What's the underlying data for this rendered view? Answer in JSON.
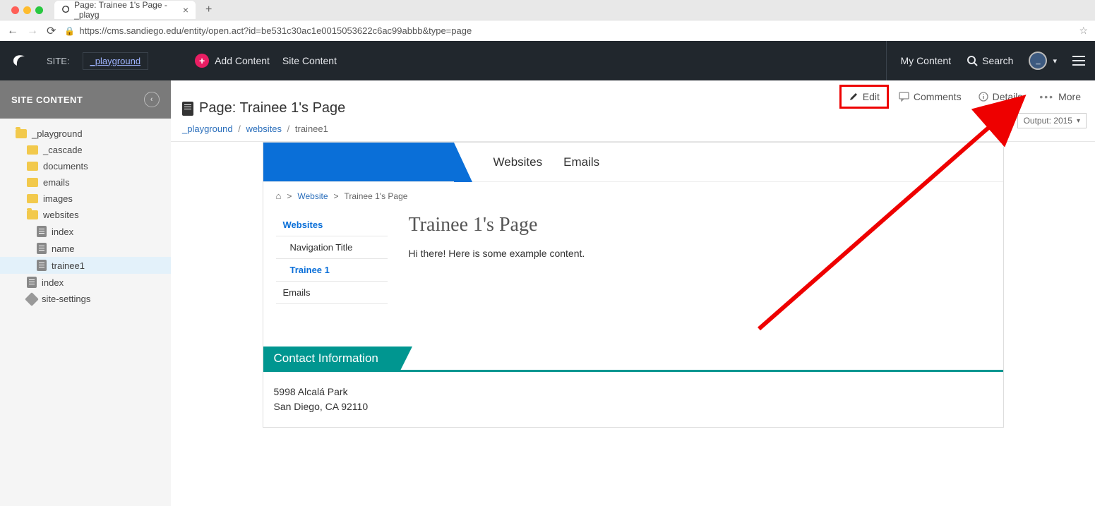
{
  "browser": {
    "tab_title": "Page: Trainee 1's Page - _playg",
    "url": "https://cms.sandiego.edu/entity/open.act?id=be531c30ac1e0015053622c6ac99abbb&type=page"
  },
  "appbar": {
    "site_label": "SITE:",
    "site_name": "_playground",
    "add_content": "Add Content",
    "site_content": "Site Content",
    "my_content": "My Content",
    "search": "Search",
    "avatar_initial": "_"
  },
  "sidebar": {
    "header": "SITE CONTENT",
    "tree": {
      "root": "_playground",
      "cascade": "_cascade",
      "documents": "documents",
      "emails": "emails",
      "images": "images",
      "websites": "websites",
      "index2": "index",
      "name": "name",
      "trainee1": "trainee1",
      "index": "index",
      "site_settings": "site-settings"
    }
  },
  "actions": {
    "edit": "Edit",
    "comments": "Comments",
    "details": "Details",
    "more": "More"
  },
  "page": {
    "title": "Page: Trainee 1's Page",
    "crumb1": "_playground",
    "crumb2": "websites",
    "crumb3": "trainee1",
    "output_label": "Output: 2015"
  },
  "preview": {
    "nav1": "Websites",
    "nav2": "Emails",
    "bc1": "Website",
    "bc2": "Trainee 1's Page",
    "side_websites": "Websites",
    "side_navtitle": "Navigation Title",
    "side_trainee": "Trainee 1",
    "side_emails": "Emails",
    "heading": "Trainee 1's Page",
    "body": "Hi there! Here is some example content.",
    "contact_header": "Contact Information",
    "addr1": "5998 Alcalá Park",
    "addr2": "San Diego, CA 92110"
  }
}
